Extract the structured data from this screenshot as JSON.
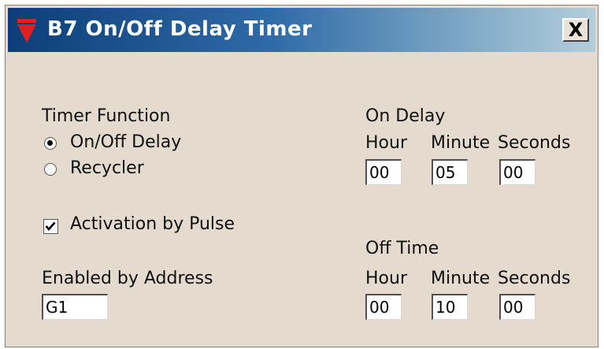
{
  "window": {
    "title": "B7   On/Off Delay Timer",
    "close_label": "X"
  },
  "timer_function": {
    "heading": "Timer Function",
    "options": [
      {
        "label": "On/Off Delay",
        "selected": true
      },
      {
        "label": "Recycler",
        "selected": false
      }
    ]
  },
  "activation": {
    "label": "Activation by Pulse",
    "checked": true
  },
  "enabled_by": {
    "label": "Enabled by Address",
    "value": "G1"
  },
  "on_delay": {
    "heading": "On Delay",
    "hour_label": "Hour",
    "minute_label": "Minute",
    "seconds_label": "Seconds",
    "hour": "00",
    "minute": "05",
    "seconds": "00"
  },
  "off_time": {
    "heading": "Off Time",
    "hour_label": "Hour",
    "minute_label": "Minute",
    "seconds_label": "Seconds",
    "hour": "00",
    "minute": "10",
    "seconds": "00"
  },
  "colors": {
    "dialog_background": "#e4dacd",
    "title_gradient_start": "#0c3e78",
    "title_gradient_end": "#b3cedb",
    "icon_red": "#e02020"
  }
}
